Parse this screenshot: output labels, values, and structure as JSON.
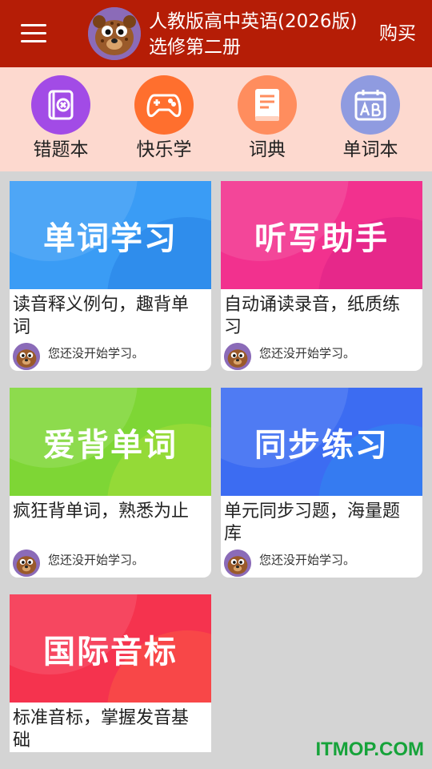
{
  "header": {
    "title_line1": "人教版高中英语(2026版)",
    "title_line2": "选修第二册",
    "buy_label": "购买"
  },
  "quick_items": [
    {
      "label": "错题本",
      "icon": "wrong-notebook-icon",
      "color": "#a24be6"
    },
    {
      "label": "快乐学",
      "icon": "gamepad-icon",
      "color": "#ff6f2e"
    },
    {
      "label": "词典",
      "icon": "dictionary-icon",
      "color": "#ff8d5e"
    },
    {
      "label": "单词本",
      "icon": "calendar-ab-icon",
      "color": "#8f9be0"
    }
  ],
  "cards": [
    {
      "title": "单词学习",
      "desc": "读音释义例句，趣背单词",
      "status": "您还没开始学习。",
      "color": "#3a9cf5"
    },
    {
      "title": "听写助手",
      "desc": "自动诵读录音，纸质练习",
      "status": "您还没开始学习。",
      "color": "#f2318e"
    },
    {
      "title": "爱背单词",
      "desc": "疯狂背单词，熟悉为止",
      "status": "您还没开始学习。",
      "color": "#7ed635"
    },
    {
      "title": "同步练习",
      "desc": "单元同步习题，海量题库",
      "status": "您还没开始学习。",
      "color": "#3c6cf2"
    },
    {
      "title": "国际音标",
      "desc": "标准音标，掌握发音基础",
      "color": "#f5334e"
    }
  ],
  "watermark": "ITMOP.COM"
}
